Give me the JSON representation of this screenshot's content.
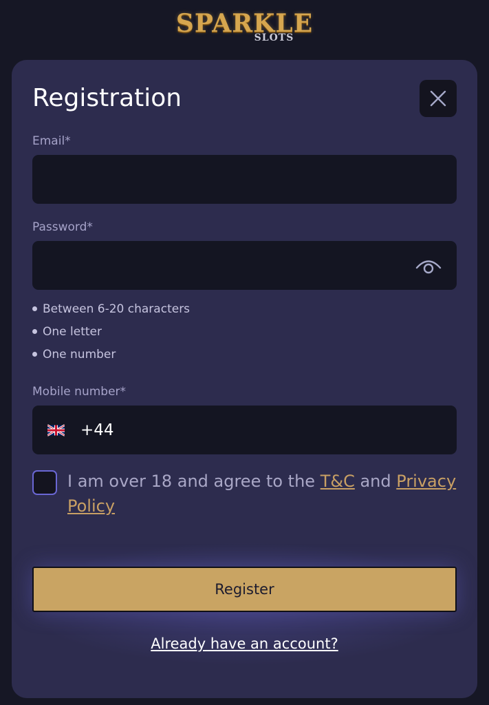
{
  "logo": {
    "main": "SPARKLE",
    "sub": "SLOTS"
  },
  "form": {
    "title": "Registration",
    "email": {
      "label": "Email*",
      "value": "",
      "placeholder": ""
    },
    "password": {
      "label": "Password*",
      "value": "",
      "placeholder": ""
    },
    "password_rules": [
      "Between 6-20 characters",
      "One letter",
      "One number"
    ],
    "mobile": {
      "label": "Mobile number*",
      "country": "GB",
      "prefix": "+44",
      "value": ""
    },
    "terms": {
      "text_before": "I am over 18 and agree to the ",
      "tc_link": "T&C",
      "text_middle": " and ",
      "privacy_link": "Privacy Policy",
      "checked": false
    },
    "register_label": "Register",
    "login_link": "Already have an account?"
  },
  "icons": {
    "close": "close-icon",
    "eye": "eye-icon",
    "flag": "uk-flag-icon"
  },
  "colors": {
    "accent": "#c9a463",
    "card": "#2d2c4e",
    "background": "#161725",
    "input": "#141522"
  }
}
